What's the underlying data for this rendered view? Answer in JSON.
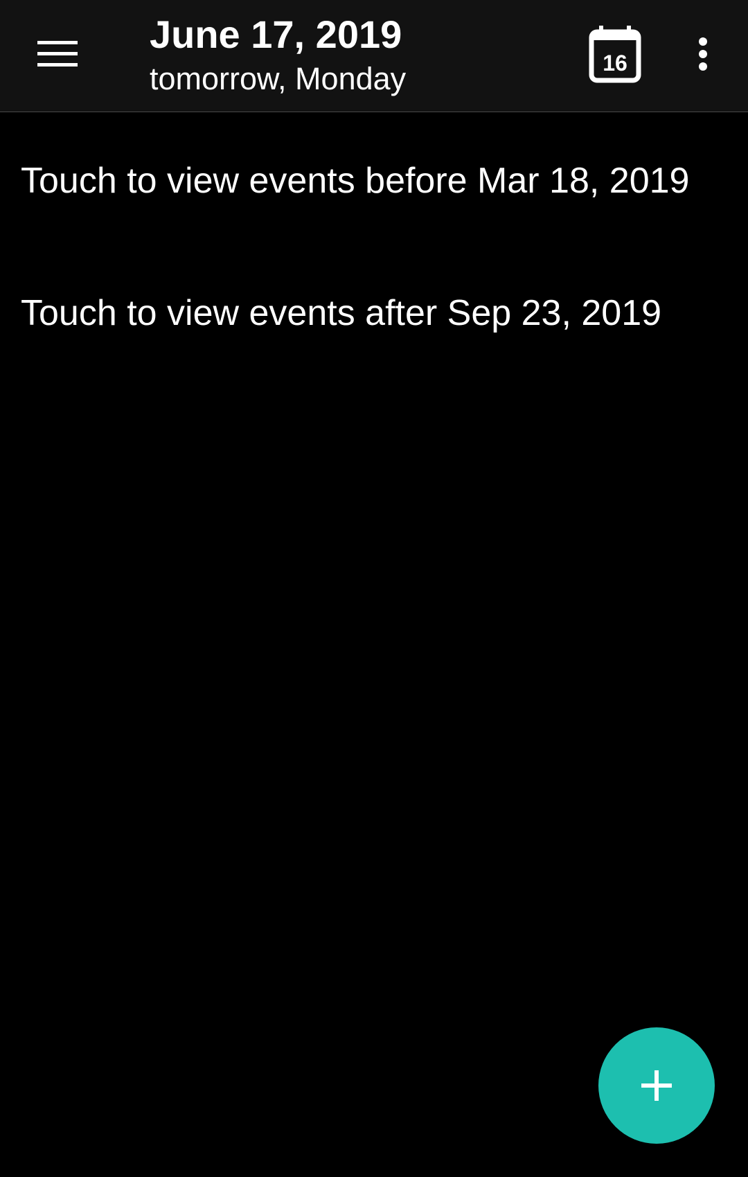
{
  "toolbar": {
    "menu_icon": "hamburger-menu-icon",
    "title": "June 17, 2019",
    "subtitle": "tomorrow, Monday",
    "calendar_icon": "calendar-today-icon",
    "calendar_day": "16",
    "more_icon": "more-vertical-icon"
  },
  "events": {
    "before_link": "Touch to view events before Mar 18, 2019",
    "after_link": "Touch to view events after Sep 23, 2019"
  },
  "fab": {
    "icon": "plus-icon"
  },
  "colors": {
    "background": "#000000",
    "toolbar_background": "#121212",
    "accent": "#1dbfaf",
    "text": "#ffffff"
  }
}
